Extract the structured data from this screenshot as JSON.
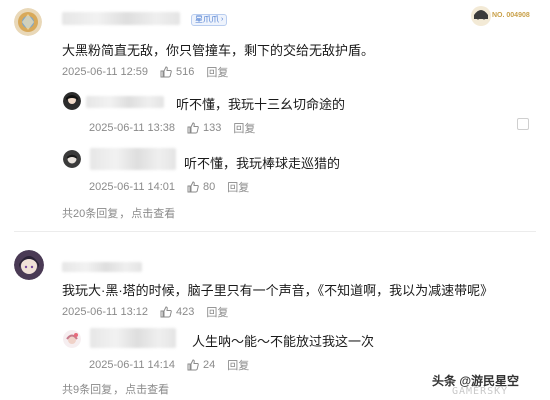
{
  "comment1": {
    "badge": "星爪爪",
    "text": "大黑粉简直无敌，你只管撞车，剩下的交给无敌护盾。",
    "date": "2025-06-11 12:59",
    "likes": "516",
    "reply_label": "回复",
    "level_badge": "NO. 004908",
    "replies": [
      {
        "text": "听不懂，我玩十三幺切命途的",
        "date": "2025-06-11 13:38",
        "likes": "133",
        "reply_label": "回复"
      },
      {
        "text": "听不懂，我玩棒球走巡猎的",
        "date": "2025-06-11 14:01",
        "likes": "80",
        "reply_label": "回复"
      }
    ],
    "more_replies": {
      "prefix": "共20条回复",
      "dot": "，",
      "action": "点击查看"
    }
  },
  "comment2": {
    "text": "我玩大·黑·塔的时候，脑子里只有一个声音，《不知道啊，我以为减速带呢》",
    "date": "2025-06-11 13:12",
    "likes": "423",
    "reply_label": "回复",
    "replies": [
      {
        "text": "人生呐～能～不能放过我这一次",
        "date": "2025-06-11 14:14",
        "likes": "24",
        "reply_label": "回复"
      }
    ],
    "more_replies": {
      "prefix": "共9条回复",
      "dot": "，",
      "action": "点击查看"
    }
  },
  "watermark": {
    "text": "头条 @游民星空",
    "sub": "GAMERSKY"
  },
  "colors": {
    "meta": "#8a8a8a",
    "badge": "#4a7bd0",
    "divider": "#ececec"
  }
}
